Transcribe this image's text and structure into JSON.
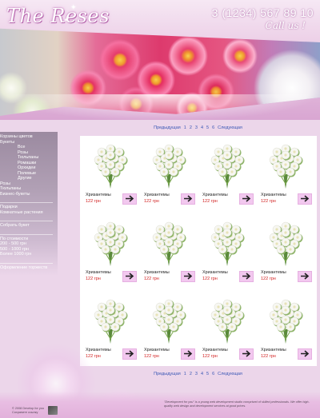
{
  "header": {
    "logo": "The Reses",
    "phone": "3 (1234) 567 89 10",
    "call_us": "Call us !"
  },
  "sidebar": {
    "groups": [
      {
        "items": [
          {
            "label": "Корзины цветов",
            "level": 0
          },
          {
            "label": "Букеты",
            "level": 0
          },
          {
            "label": "Все",
            "level": 1
          },
          {
            "label": "Розы",
            "level": 1
          },
          {
            "label": "Тюльпаны",
            "level": 1
          },
          {
            "label": "Ромашки",
            "level": 1
          },
          {
            "label": "Орхидеи",
            "level": 1
          },
          {
            "label": "Полевые",
            "level": 1
          },
          {
            "label": "Другие",
            "level": 1
          },
          {
            "label": "Розы",
            "level": 0
          },
          {
            "label": "Тюльпаны",
            "level": 0
          },
          {
            "label": "Бизнес-букеты",
            "level": 0
          }
        ]
      },
      {
        "items": [
          {
            "label": "Подарки",
            "level": 0
          },
          {
            "label": "Комнатные растения",
            "level": 0
          }
        ]
      },
      {
        "items": [
          {
            "label": "Собрать букет",
            "level": 0
          }
        ]
      },
      {
        "items": [
          {
            "label": "По стоимости",
            "level": 0
          },
          {
            "label": "200 - 500 грн",
            "level": 0
          },
          {
            "label": "500 - 1000 грн",
            "level": 0
          },
          {
            "label": "Более 1000 грн",
            "level": 0
          }
        ]
      },
      {
        "items": [
          {
            "label": "Оформление торжеств",
            "level": 0
          }
        ]
      }
    ]
  },
  "pagination": {
    "prev": "Предыдущая",
    "pages": [
      "1",
      "2",
      "3",
      "4",
      "5",
      "6"
    ],
    "next": "Следующая"
  },
  "products": [
    {
      "name": "Хризантемы",
      "price": "122 грн"
    },
    {
      "name": "Хризантемы",
      "price": "122 грн"
    },
    {
      "name": "Хризантемы",
      "price": "122 грн"
    },
    {
      "name": "Хризантемы",
      "price": "122 грн"
    },
    {
      "name": "Хризантемы",
      "price": "122 грн"
    },
    {
      "name": "Хризантемы",
      "price": "122 грн"
    },
    {
      "name": "Хризантемы",
      "price": "122 грн"
    },
    {
      "name": "Хризантемы",
      "price": "122 грн"
    },
    {
      "name": "Хризантемы",
      "price": "122 грн"
    },
    {
      "name": "Хризантемы",
      "price": "122 грн"
    },
    {
      "name": "Хризантемы",
      "price": "122 грн"
    },
    {
      "name": "Хризантемы",
      "price": "122 грн"
    }
  ],
  "icons": {
    "cart_button": "arrow-right-icon",
    "product_image": "bouquet-icon"
  },
  "colors": {
    "accent_pink": "#f2c8ef",
    "price_red": "#d11c1c",
    "link_blue": "#3a57b5",
    "background": "#ecd6ea"
  },
  "footer": {
    "copyright_line1": "© 2008 Develop for you",
    "copyright_line2": "Сохраните ссылку",
    "about": "\"Development for you\" is a young web development studio comprised of skilled professionals. We offer high-quality web design and development services at good prices."
  }
}
